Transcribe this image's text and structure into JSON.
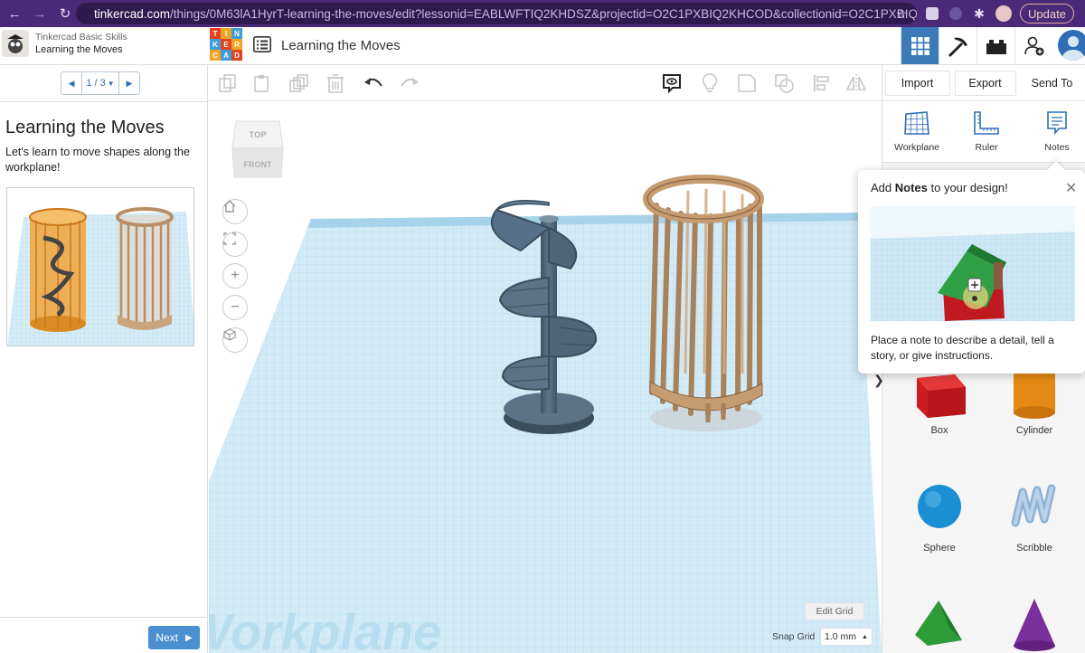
{
  "browser": {
    "url_host": "tinkercad.com",
    "url_path": "/things/0M63lA1HyrT-learning-the-moves/edit?lessonid=EABLWFTIQ2KHDSZ&projectid=O2C1PXBIQ2KHCOD&collectionid=O2C1PXBIQ2K...",
    "update_label": "Update",
    "icons": [
      "back-icon",
      "forward-icon",
      "reload-icon",
      "lock-icon",
      "star-icon",
      "extension-icon",
      "puzzle-icon",
      "profile-icon"
    ]
  },
  "header": {
    "course_title": "Tinkercad Basic Skills",
    "course_subtitle": "Learning the Moves",
    "logo_letters": [
      "T",
      "I",
      "N",
      "K",
      "E",
      "R",
      "C",
      "A",
      "D"
    ],
    "logo_colors": [
      "#e2441f",
      "#f2a425",
      "#3f9ed9",
      "#3f9ed9",
      "#e2441f",
      "#f2a425",
      "#f2a425",
      "#3f9ed9",
      "#e2441f"
    ],
    "design_title": "Learning the Moves",
    "accent": "#3a7ab8"
  },
  "lesson": {
    "pager": "1 / 3",
    "title": "Learning the Moves",
    "description": "Let's learn to move shapes along the workplane!",
    "next_label": "Next"
  },
  "toolbar": {
    "import_label": "Import",
    "export_label": "Export",
    "send_to_label": "Send To"
  },
  "viewcube": {
    "top_label": "TOP",
    "front_label": "FRONT"
  },
  "workplane": {
    "watermark": "Workplane",
    "edit_grid_label": "Edit Grid",
    "snap_grid_label": "Snap Grid",
    "snap_grid_value": "1.0 mm"
  },
  "tools": {
    "workplane_label": "Workplane",
    "ruler_label": "Ruler",
    "notes_label": "Notes"
  },
  "notes_popup": {
    "title_pre": "Add ",
    "title_bold": "Notes",
    "title_post": " to your design!",
    "body": "Place a note to describe a detail, tell a story, or give instructions."
  },
  "shapes": {
    "box_label": "Box",
    "cylinder_label": "Cylinder",
    "sphere_label": "Sphere",
    "scribble_label": "Scribble"
  }
}
